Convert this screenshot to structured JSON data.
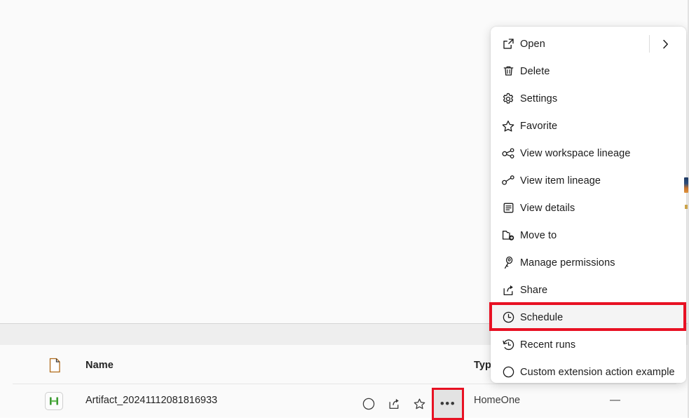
{
  "window": {
    "background_color": "#fafafa",
    "accent_highlight_color": "#e81123"
  },
  "list": {
    "header": {
      "doc_icon": "document-icon",
      "name_label": "Name",
      "type_label": "Typ"
    },
    "rows": [
      {
        "icon": "artifact-green-icon",
        "name": "Artifact_20241112081816933",
        "type": "HomeOne",
        "extra": "—",
        "actions": [
          {
            "name": "circle-icon",
            "glyph": "circle"
          },
          {
            "name": "share-icon",
            "glyph": "share"
          },
          {
            "name": "favorite-star-icon",
            "glyph": "star"
          },
          {
            "name": "more-actions-icon",
            "glyph": "•••"
          }
        ]
      }
    ]
  },
  "context_menu": {
    "items": [
      {
        "label": "Open",
        "icon": "open-external-icon",
        "has_submenu": true
      },
      {
        "label": "Delete",
        "icon": "trash-icon",
        "has_submenu": false
      },
      {
        "label": "Settings",
        "icon": "gear-icon",
        "has_submenu": false
      },
      {
        "label": "Favorite",
        "icon": "star-icon",
        "has_submenu": false
      },
      {
        "label": "View workspace lineage",
        "icon": "workspace-lineage-icon",
        "has_submenu": false
      },
      {
        "label": "View item lineage",
        "icon": "item-lineage-icon",
        "has_submenu": false
      },
      {
        "label": "View details",
        "icon": "details-icon",
        "has_submenu": false
      },
      {
        "label": "Move to",
        "icon": "move-to-folder-icon",
        "has_submenu": false
      },
      {
        "label": "Manage permissions",
        "icon": "key-icon",
        "has_submenu": false
      },
      {
        "label": "Share",
        "icon": "share-icon",
        "has_submenu": false
      },
      {
        "label": "Schedule",
        "icon": "clock-icon",
        "has_submenu": false,
        "highlighted": true
      },
      {
        "label": "Recent runs",
        "icon": "history-icon",
        "has_submenu": false
      },
      {
        "label": "Custom extension action example",
        "icon": "circle-icon",
        "has_submenu": false
      }
    ]
  }
}
